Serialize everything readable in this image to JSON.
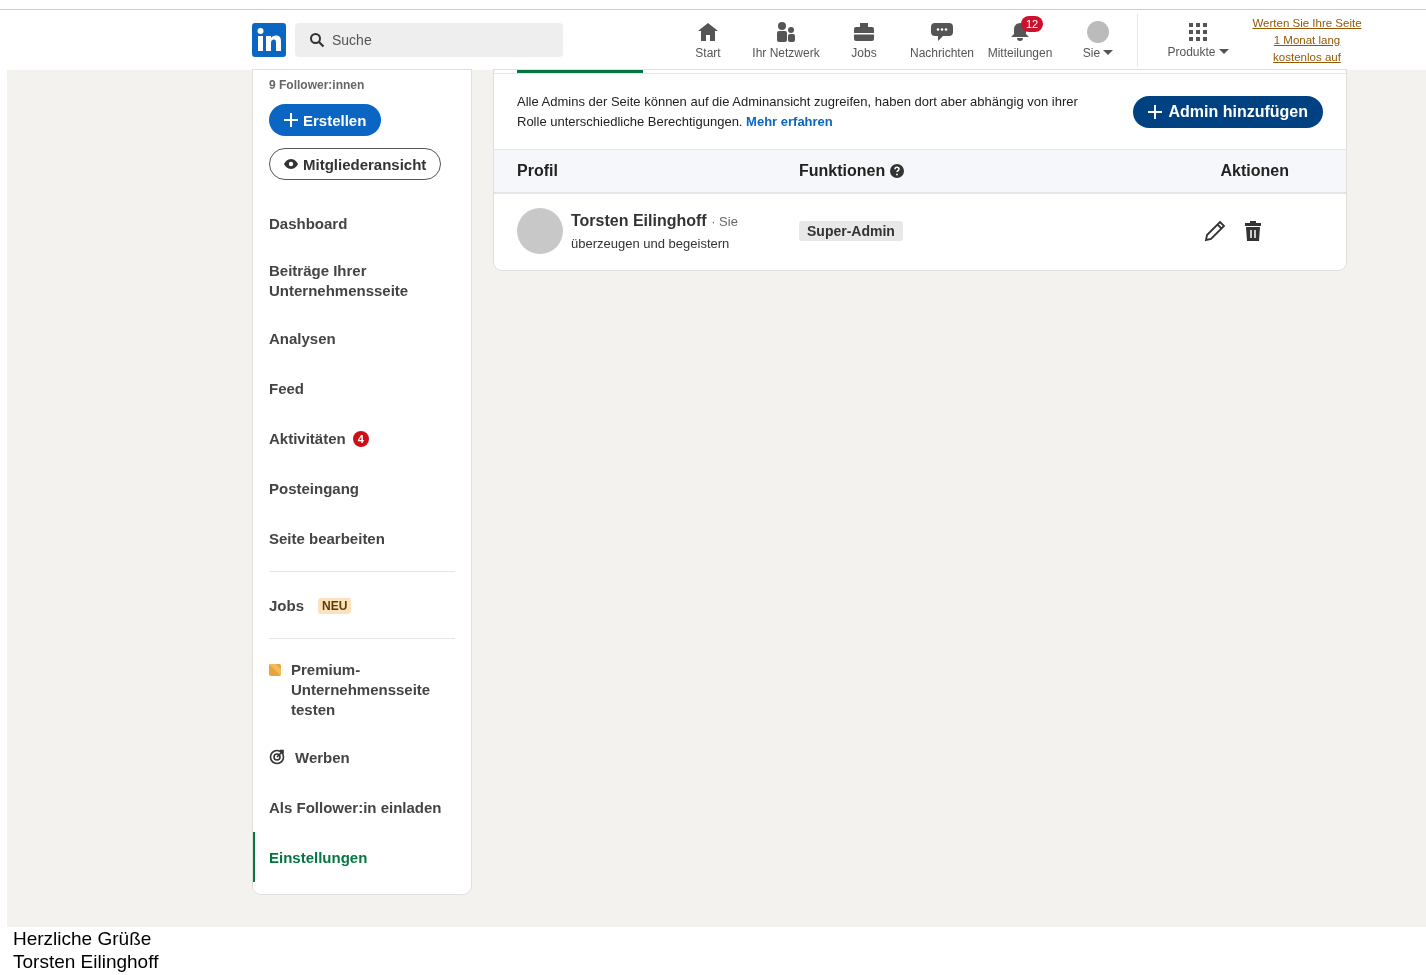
{
  "navbar": {
    "search": {
      "placeholder": "Suche"
    },
    "items": [
      {
        "label": "Start",
        "kind": "home"
      },
      {
        "label": "Ihr Netzwerk",
        "kind": "people"
      },
      {
        "label": "Jobs",
        "kind": "briefcase"
      },
      {
        "label": "Nachrichten",
        "kind": "chat"
      },
      {
        "label": "Mitteilungen",
        "kind": "bell",
        "badge": "12"
      },
      {
        "label": "Sie",
        "kind": "avatar",
        "dropdown": true
      }
    ],
    "products": {
      "label": "Produkte",
      "dropdown": true
    },
    "premium_link": "Werten Sie Ihre Seite 1 Monat lang kostenlos auf"
  },
  "sidebar": {
    "followers": "9 Follower:innen",
    "create_button": "Erstellen",
    "member_view_button": "Mitgliederansicht",
    "groups": [
      [
        {
          "kind": "plain",
          "label": "Dashboard",
          "selected": false
        },
        {
          "kind": "plain",
          "label": "Beiträge Ihrer Unternehmensseite",
          "selected": false
        },
        {
          "kind": "plain",
          "label": "Analysen",
          "selected": false
        },
        {
          "kind": "plain",
          "label": "Feed",
          "selected": false
        },
        {
          "kind": "count",
          "label": "Aktivitäten",
          "badge": "4",
          "selected": false
        },
        {
          "kind": "plain",
          "label": "Posteingang",
          "selected": false
        },
        {
          "kind": "plain",
          "label": "Seite bearbeiten",
          "selected": false
        }
      ],
      [
        {
          "kind": "tag",
          "label": "Jobs",
          "badge": "NEU",
          "selected": false
        }
      ],
      [
        {
          "kind": "premium",
          "label": "Premium-Unternehmensseite testen",
          "selected": false
        },
        {
          "kind": "target",
          "label": "Werben",
          "selected": false
        },
        {
          "kind": "plain",
          "label": "Als Follower:in einladen",
          "selected": false
        },
        {
          "kind": "plain",
          "label": "Einstellungen",
          "selected": true
        }
      ]
    ]
  },
  "admins": {
    "intro": "Alle Admins der Seite können auf die Adminansicht zugreifen, haben dort aber abhängig von ihrer Rolle unterschiedliche Berechtigungen.",
    "learn_more": "Mehr erfahren",
    "add_button": "Admin hinzufügen",
    "table": {
      "columns": [
        "Profil",
        "Funktionen",
        "Aktionen"
      ],
      "rows": [
        {
          "name": "Torsten Eilinghoff",
          "you": "· Sie",
          "headline": "überzeugen und begeistern",
          "role": "Super-Admin"
        }
      ]
    }
  },
  "footer": [
    "Herzliche Grüße",
    "Torsten Eilinghoff"
  ]
}
